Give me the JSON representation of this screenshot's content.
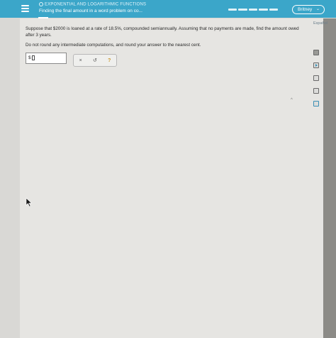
{
  "header": {
    "topic": "EXPONENTIAL AND LOGARITHMIC FUNCTIONS",
    "subtitle": "Finding the final amount in a word problem on co...",
    "user_name": "Britney",
    "progress_segments": 5
  },
  "language_link": "Español",
  "problem": {
    "pre": "Suppose that ",
    "principal": "$2000",
    "mid1": " is loaned at a rate of ",
    "rate": "18.5%",
    "mid2": ", compounded semiannually. Assuming that no payments are made, find the amount owed after ",
    "years": "3",
    "post": " years.",
    "instructions": "Do not round any intermediate computations, and round your answer to the nearest cent."
  },
  "answer": {
    "currency": "$",
    "value": ""
  },
  "tools": {
    "clear": "×",
    "undo": "↺",
    "help": "?"
  },
  "icons": [
    "menu-icon",
    "chevron-down-icon",
    "calculator-icon",
    "play-icon",
    "book-icon",
    "calendar-icon",
    "mail-icon",
    "pointer-icon"
  ]
}
